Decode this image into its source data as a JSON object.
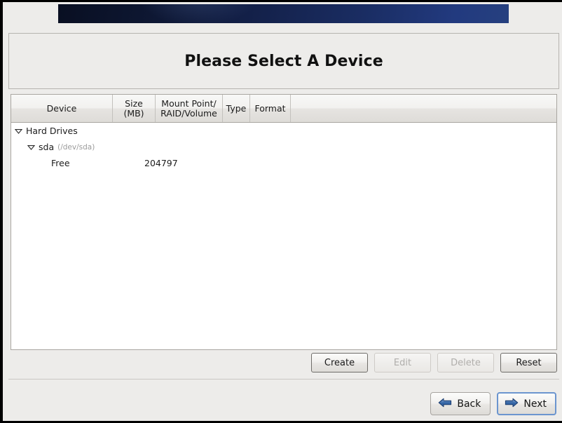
{
  "window": {
    "banner_icon": "installer-banner-gradient"
  },
  "header": {
    "title": "Please Select A Device"
  },
  "tree": {
    "columns": [
      {
        "id": "device",
        "label": "Device"
      },
      {
        "id": "size",
        "label": "Size\n(MB)",
        "line1": "Size",
        "line2": "(MB)"
      },
      {
        "id": "mount",
        "label": "Mount Point/\nRAID/Volume",
        "line1": "Mount Point/",
        "line2": "RAID/Volume"
      },
      {
        "id": "type",
        "label": "Type"
      },
      {
        "id": "format",
        "label": "Format"
      },
      {
        "id": "filler",
        "label": ""
      }
    ],
    "rows": [
      {
        "depth": 0,
        "expander": "triangle-down-icon",
        "device": "Hard Drives",
        "device_sub": "",
        "size": "",
        "mount": "",
        "type": "",
        "format": ""
      },
      {
        "depth": 1,
        "expander": "triangle-down-icon",
        "device": "sda",
        "device_sub": "(/dev/sda)",
        "size": "",
        "mount": "",
        "type": "",
        "format": ""
      },
      {
        "depth": 2,
        "expander": "none",
        "device": "Free",
        "device_sub": "",
        "size": "204797",
        "mount": "",
        "type": "",
        "format": ""
      }
    ]
  },
  "actions": {
    "create": {
      "label": "Create",
      "enabled": true
    },
    "edit": {
      "label": "Edit",
      "enabled": false
    },
    "delete": {
      "label": "Delete",
      "enabled": false
    },
    "reset": {
      "label": "Reset",
      "enabled": true
    }
  },
  "nav": {
    "back": {
      "label": "Back",
      "icon": "arrow-left-icon"
    },
    "next": {
      "label": "Next",
      "icon": "arrow-right-icon",
      "is_default": true
    }
  },
  "colors": {
    "banner_dark": "#090f22",
    "banner_light": "#26407f",
    "arrow_blue": "#3465a4",
    "focus_blue": "#6b95cf",
    "panel_bg": "#edecea",
    "tree_bg": "#ffffff"
  }
}
